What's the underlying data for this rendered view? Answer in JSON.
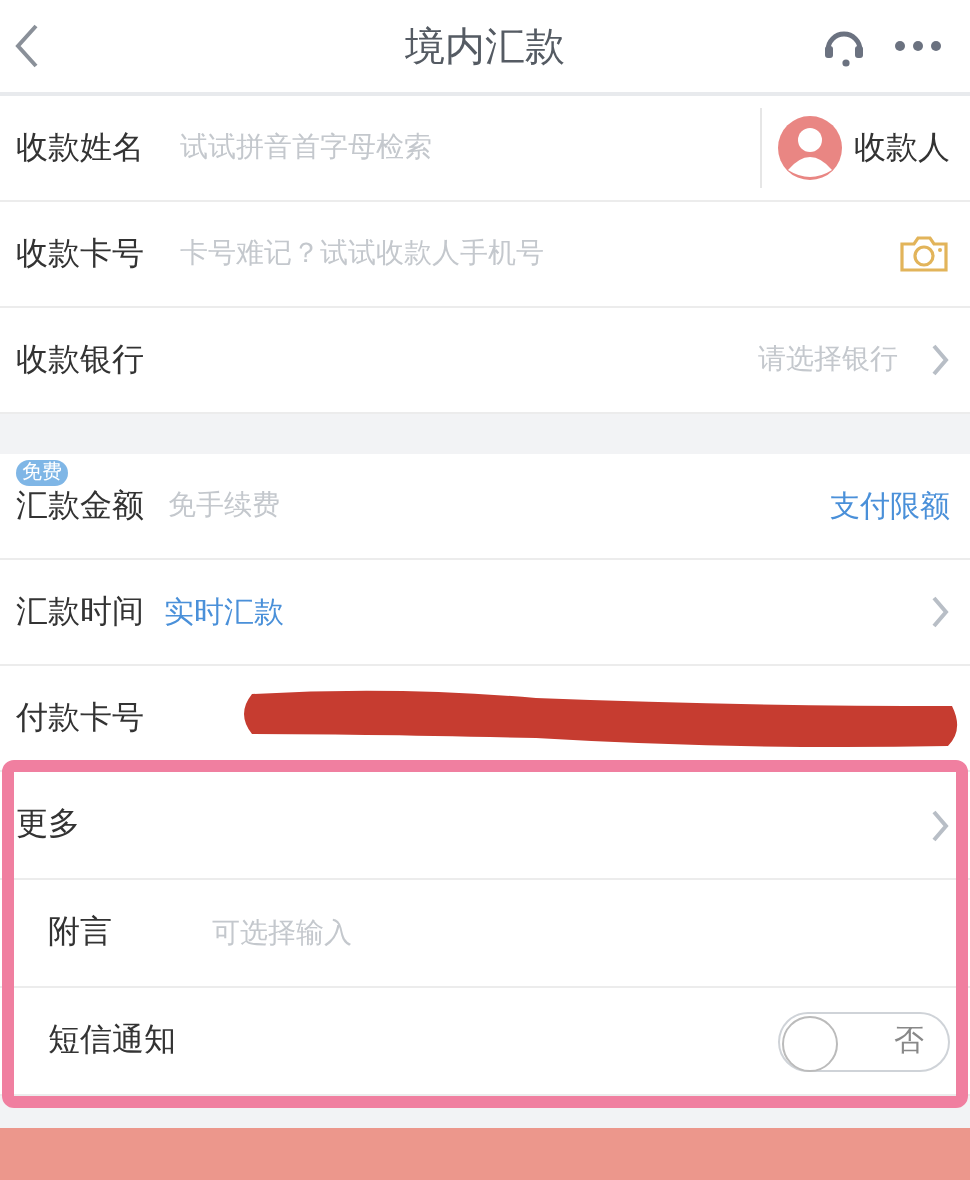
{
  "header": {
    "title": "境内汇款"
  },
  "rows": [
    {
      "kind": "payee",
      "label": "收款姓名",
      "placeholder": "试试拼音首字母检索",
      "action": "收款人"
    },
    {
      "kind": "camera",
      "label": "收款卡号",
      "placeholder": "卡号难记？试试收款人手机号"
    },
    {
      "kind": "select",
      "label": "收款银行",
      "hint": "请选择银行"
    }
  ],
  "amount_rows": [
    {
      "kind": "amount",
      "badge": "免费",
      "label": "汇款金额",
      "placeholder": "免手续费",
      "link": "支付限额"
    },
    {
      "kind": "time",
      "label": "汇款时间",
      "value": "实时汇款"
    },
    {
      "kind": "card",
      "label": "付款卡号",
      "redacted": true
    }
  ],
  "more_rows": [
    {
      "kind": "more",
      "label": "更多"
    },
    {
      "kind": "note",
      "label": "附言",
      "placeholder": "可选择输入"
    },
    {
      "kind": "sms",
      "label": "短信通知",
      "on": false,
      "state_text": "否"
    }
  ],
  "annotation": {
    "highlighted": true
  }
}
